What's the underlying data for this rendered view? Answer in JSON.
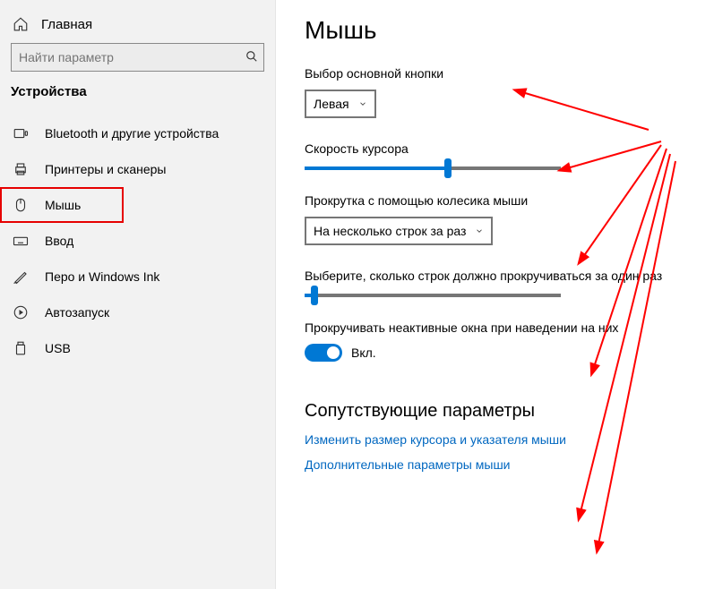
{
  "sidebar": {
    "home": "Главная",
    "search_placeholder": "Найти параметр",
    "section": "Устройства",
    "items": [
      {
        "label": "Bluetooth и другие устройства"
      },
      {
        "label": "Принтеры и сканеры"
      },
      {
        "label": "Мышь"
      },
      {
        "label": "Ввод"
      },
      {
        "label": "Перо и Windows Ink"
      },
      {
        "label": "Автозапуск"
      },
      {
        "label": "USB"
      }
    ]
  },
  "main": {
    "title": "Мышь",
    "primary_button": {
      "label": "Выбор основной кнопки",
      "value": "Левая"
    },
    "cursor_speed": {
      "label": "Скорость курсора",
      "percent": 56
    },
    "scroll_wheel": {
      "label": "Прокрутка с помощью колесика мыши",
      "value": "На несколько строк за раз"
    },
    "lines_to_scroll": {
      "label": "Выберите, сколько строк должно прокручиваться за один раз",
      "percent": 4
    },
    "scroll_inactive": {
      "label": "Прокручивать неактивные окна при наведении на них",
      "state": "Вкл."
    },
    "related": {
      "heading": "Сопутствующие параметры",
      "link1": "Изменить размер курсора и указателя мыши",
      "link2": "Дополнительные параметры мыши"
    }
  }
}
